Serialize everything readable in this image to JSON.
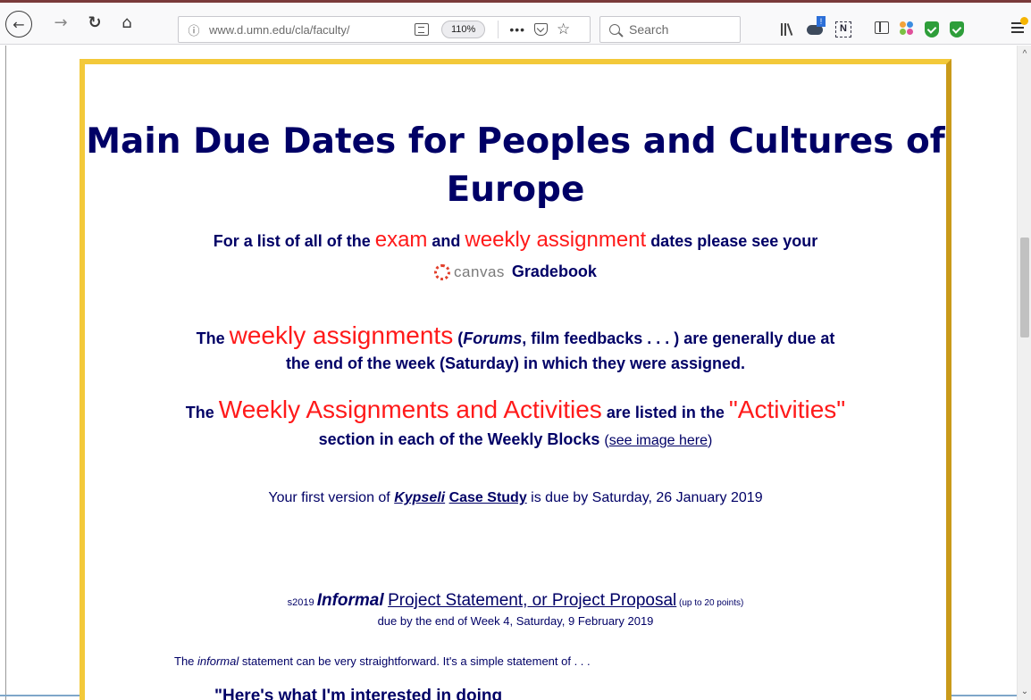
{
  "browser": {
    "url": "www.d.umn.edu/cla/faculty/",
    "zoom": "110%",
    "overflow_menu": "•••",
    "search_placeholder": "Search"
  },
  "page": {
    "title": "Main Due Dates for Peoples and Cultures of Europe",
    "p1": {
      "pre": "For a list of all of the ",
      "exam": "exam",
      "mid": " and ",
      "weekly": "weekly assignment",
      "post": " dates please see your"
    },
    "canvas": {
      "logo_text": "canvas",
      "gradebook": "Gradebook"
    },
    "p2": {
      "pre": "The ",
      "weekly": "weekly assignments",
      "paren_open": " (",
      "forums": "Forums",
      "rest": ", film feedbacks . . . ) are generally due at",
      "line2": "the end of the week (Saturday) in which they were assigned."
    },
    "p3": {
      "pre": "The ",
      "weekly": "Weekly Assignments and Activities",
      "mid": " are listed in the ",
      "activities": "\"Activities\"",
      "line2": "section in each of the Weekly Blocks ",
      "link_open": "(",
      "link": "see image here",
      "link_close": ")"
    },
    "p4": {
      "pre": "Your first version of ",
      "kypseli": "Kypseli",
      "space": " ",
      "case_study": "Case Study",
      "post": " is due by Saturday, 26 January 2019"
    },
    "p5": {
      "s2019": "s2019 ",
      "informal": "Informal",
      "space": " ",
      "proposal": "Project Statement, or Project Proposal",
      "points": " (up to 20 points)",
      "due": "due by the end of Week 4, Saturday, 9 February 2019"
    },
    "p6": {
      "pre": "The ",
      "informal": "informal",
      "post": " statement can be very straightforward. It's a simple statement of . . ."
    },
    "p7": "\"Here's what I'm interested in doing"
  },
  "colors": {
    "navy": "#000066",
    "red": "#ff1a1a",
    "frame_light": "#f3c93a",
    "frame_dark": "#c99a1a"
  }
}
